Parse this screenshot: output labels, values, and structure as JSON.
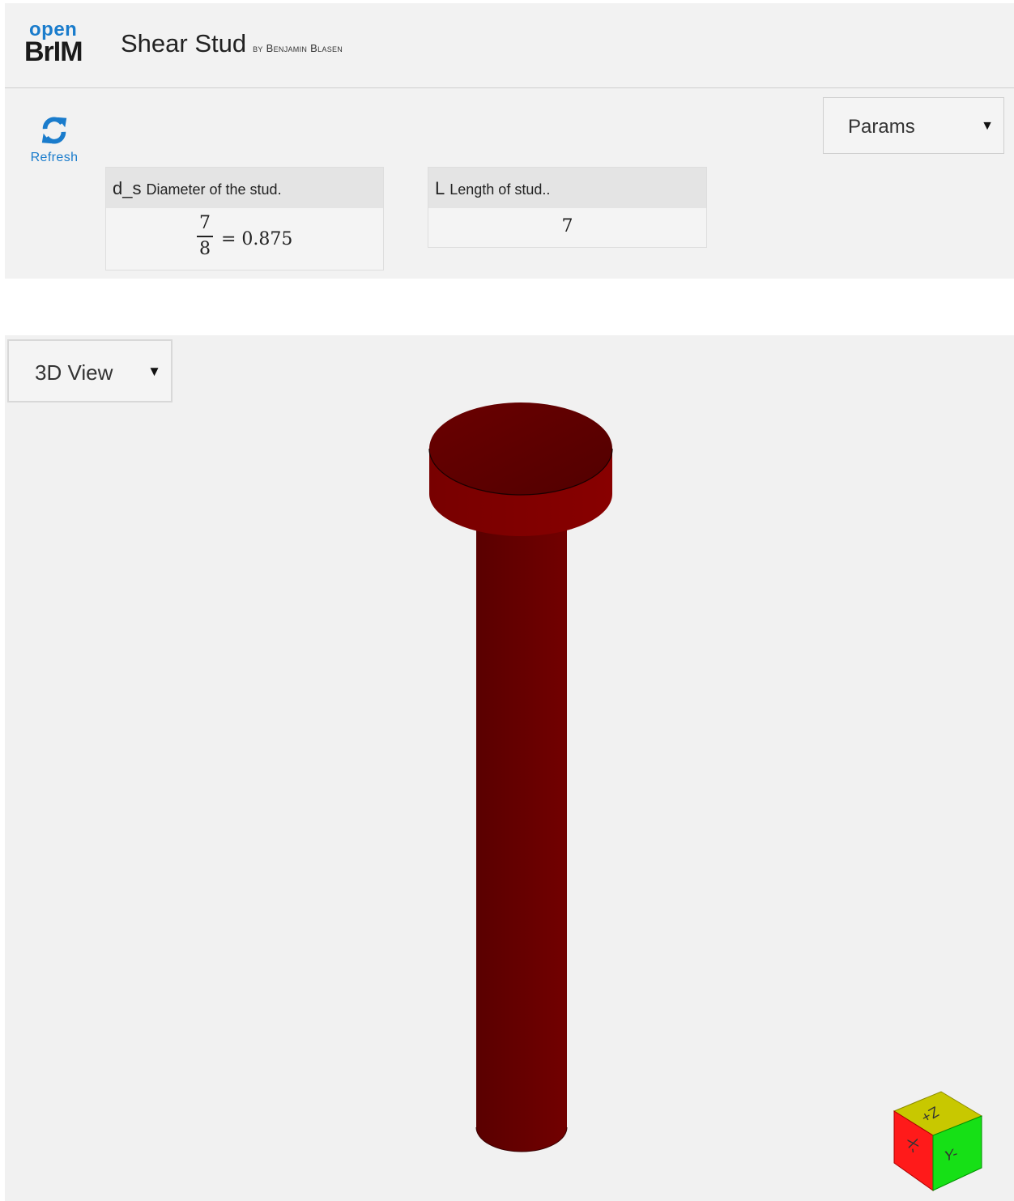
{
  "header": {
    "logo_top": "open",
    "logo_bottom": "BrIM",
    "title": "Shear Stud",
    "author": "by Benjamin Blasen"
  },
  "toolbar": {
    "refresh_label": "Refresh",
    "params_select": "Params"
  },
  "params": [
    {
      "symbol": "d_s",
      "description": "Diameter of the stud.",
      "numerator": "7",
      "denominator": "8",
      "result": "= 0.875"
    },
    {
      "symbol": "L",
      "description": "Length of stud..",
      "value": "7"
    }
  ],
  "viewer": {
    "view_select": "3D View",
    "model_color": "#6a0000",
    "nav_cube": {
      "top_label": "Z+",
      "left_label": "X-",
      "right_label": "Y-",
      "top_color": "#c8c800",
      "left_color": "#ff1a1a",
      "right_color": "#16e016"
    }
  },
  "colors": {
    "accent": "#1a7ccc",
    "panel_bg": "#f2f2f2"
  }
}
